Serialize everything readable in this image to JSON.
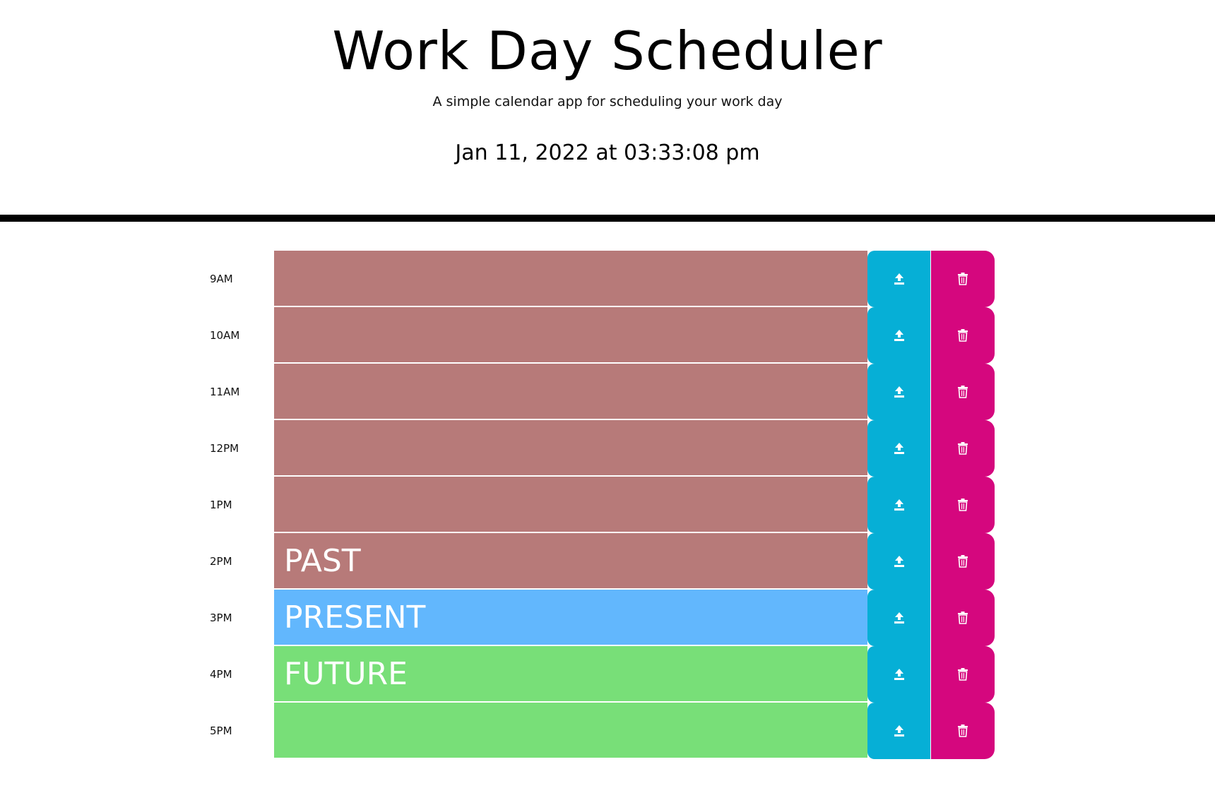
{
  "header": {
    "title": "Work Day Scheduler",
    "subtitle": "A simple calendar app for scheduling your work day",
    "datetime": "Jan 11, 2022 at 03:33:08 pm"
  },
  "colors": {
    "past": "#b77a79",
    "present": "#62b7fd",
    "future": "#78df78",
    "save_button": "#06afd6",
    "delete_button": "#d5077e"
  },
  "rows": [
    {
      "hour": "9AM",
      "status": "past",
      "text": ""
    },
    {
      "hour": "10AM",
      "status": "past",
      "text": ""
    },
    {
      "hour": "11AM",
      "status": "past",
      "text": ""
    },
    {
      "hour": "12PM",
      "status": "past",
      "text": ""
    },
    {
      "hour": "1PM",
      "status": "past",
      "text": ""
    },
    {
      "hour": "2PM",
      "status": "past",
      "text": "PAST"
    },
    {
      "hour": "3PM",
      "status": "present",
      "text": "PRESENT"
    },
    {
      "hour": "4PM",
      "status": "future",
      "text": "FUTURE"
    },
    {
      "hour": "5PM",
      "status": "future",
      "text": ""
    }
  ],
  "icons": {
    "save": "upload-icon",
    "delete": "trash-icon"
  }
}
